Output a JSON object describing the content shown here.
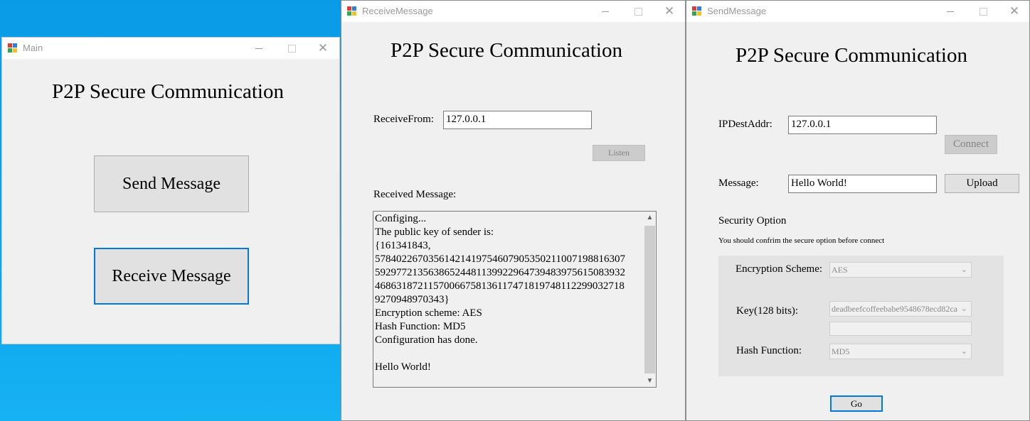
{
  "main": {
    "title": "Main",
    "heading": "P2P Secure Communication",
    "send_button": "Send Message",
    "receive_button": "Receive Message"
  },
  "receive": {
    "title": "ReceiveMessage",
    "heading": "P2P Secure Communication",
    "receive_from_label": "ReceiveFrom:",
    "receive_from_value": "127.0.0.1",
    "listen_button": "Listen",
    "received_label": "Received Message:",
    "log_lines": [
      "Configing...",
      "The public key of sender is:",
      "{161341843,",
      "578402267035614214197546079053502110071988163O7",
      "592977213563865244811399229647394839756150839 32",
      "468631872115700667581361174718197481122990327 18",
      "9270948970343}",
      "Encryption scheme: AES",
      "Hash Function: MD5",
      "Configuration has done.",
      "",
      "Hello World!"
    ]
  },
  "send": {
    "title": "SendMessage",
    "heading": "P2P Secure Communication",
    "ip_label": "IPDestAddr:",
    "ip_value": "127.0.0.1",
    "connect_button": "Connect",
    "message_label": "Message:",
    "message_value": "Hello World!",
    "upload_button": "Upload",
    "security_title": "Security Option",
    "security_note": "You should confrim the secure option before connect",
    "enc_label": "Encryption Scheme:",
    "enc_value": "AES",
    "key_label": "Key(128 bits):",
    "key_value": "deadbeefcoffeebabe9548678ecd82ca",
    "key_extra": "",
    "hash_label": "Hash Function:",
    "hash_value": "MD5",
    "go_button": "Go"
  },
  "colors": {
    "desktop": "#0aa0ea",
    "window_bg": "#f0f0f0",
    "focus_border": "#0078d7",
    "disabled_button": "#cccccc"
  }
}
